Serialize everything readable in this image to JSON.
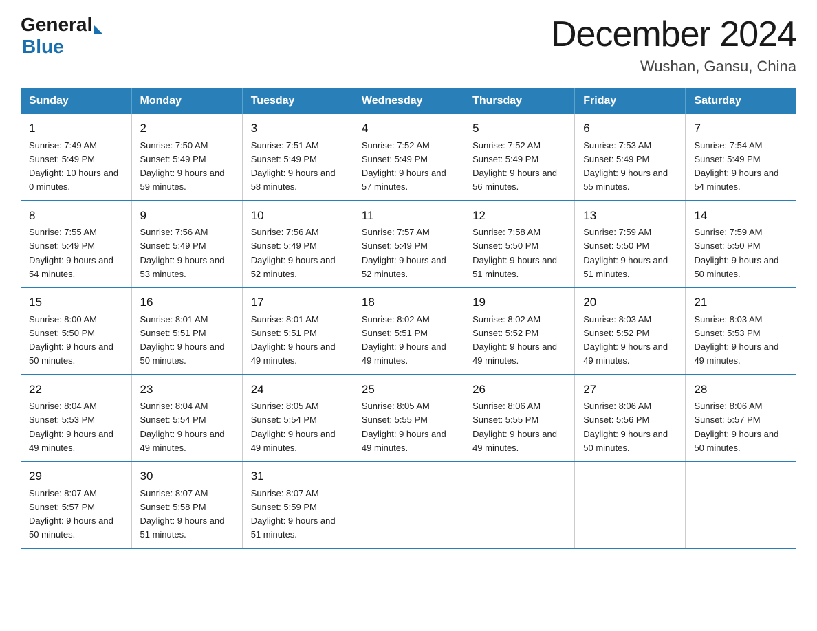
{
  "logo": {
    "text_general": "General",
    "text_blue": "Blue",
    "arrow": true
  },
  "title": "December 2024",
  "subtitle": "Wushan, Gansu, China",
  "days_of_week": [
    "Sunday",
    "Monday",
    "Tuesday",
    "Wednesday",
    "Thursday",
    "Friday",
    "Saturday"
  ],
  "weeks": [
    [
      {
        "day": "1",
        "sunrise": "7:49 AM",
        "sunset": "5:49 PM",
        "daylight": "10 hours and 0 minutes."
      },
      {
        "day": "2",
        "sunrise": "7:50 AM",
        "sunset": "5:49 PM",
        "daylight": "9 hours and 59 minutes."
      },
      {
        "day": "3",
        "sunrise": "7:51 AM",
        "sunset": "5:49 PM",
        "daylight": "9 hours and 58 minutes."
      },
      {
        "day": "4",
        "sunrise": "7:52 AM",
        "sunset": "5:49 PM",
        "daylight": "9 hours and 57 minutes."
      },
      {
        "day": "5",
        "sunrise": "7:52 AM",
        "sunset": "5:49 PM",
        "daylight": "9 hours and 56 minutes."
      },
      {
        "day": "6",
        "sunrise": "7:53 AM",
        "sunset": "5:49 PM",
        "daylight": "9 hours and 55 minutes."
      },
      {
        "day": "7",
        "sunrise": "7:54 AM",
        "sunset": "5:49 PM",
        "daylight": "9 hours and 54 minutes."
      }
    ],
    [
      {
        "day": "8",
        "sunrise": "7:55 AM",
        "sunset": "5:49 PM",
        "daylight": "9 hours and 54 minutes."
      },
      {
        "day": "9",
        "sunrise": "7:56 AM",
        "sunset": "5:49 PM",
        "daylight": "9 hours and 53 minutes."
      },
      {
        "day": "10",
        "sunrise": "7:56 AM",
        "sunset": "5:49 PM",
        "daylight": "9 hours and 52 minutes."
      },
      {
        "day": "11",
        "sunrise": "7:57 AM",
        "sunset": "5:49 PM",
        "daylight": "9 hours and 52 minutes."
      },
      {
        "day": "12",
        "sunrise": "7:58 AM",
        "sunset": "5:50 PM",
        "daylight": "9 hours and 51 minutes."
      },
      {
        "day": "13",
        "sunrise": "7:59 AM",
        "sunset": "5:50 PM",
        "daylight": "9 hours and 51 minutes."
      },
      {
        "day": "14",
        "sunrise": "7:59 AM",
        "sunset": "5:50 PM",
        "daylight": "9 hours and 50 minutes."
      }
    ],
    [
      {
        "day": "15",
        "sunrise": "8:00 AM",
        "sunset": "5:50 PM",
        "daylight": "9 hours and 50 minutes."
      },
      {
        "day": "16",
        "sunrise": "8:01 AM",
        "sunset": "5:51 PM",
        "daylight": "9 hours and 50 minutes."
      },
      {
        "day": "17",
        "sunrise": "8:01 AM",
        "sunset": "5:51 PM",
        "daylight": "9 hours and 49 minutes."
      },
      {
        "day": "18",
        "sunrise": "8:02 AM",
        "sunset": "5:51 PM",
        "daylight": "9 hours and 49 minutes."
      },
      {
        "day": "19",
        "sunrise": "8:02 AM",
        "sunset": "5:52 PM",
        "daylight": "9 hours and 49 minutes."
      },
      {
        "day": "20",
        "sunrise": "8:03 AM",
        "sunset": "5:52 PM",
        "daylight": "9 hours and 49 minutes."
      },
      {
        "day": "21",
        "sunrise": "8:03 AM",
        "sunset": "5:53 PM",
        "daylight": "9 hours and 49 minutes."
      }
    ],
    [
      {
        "day": "22",
        "sunrise": "8:04 AM",
        "sunset": "5:53 PM",
        "daylight": "9 hours and 49 minutes."
      },
      {
        "day": "23",
        "sunrise": "8:04 AM",
        "sunset": "5:54 PM",
        "daylight": "9 hours and 49 minutes."
      },
      {
        "day": "24",
        "sunrise": "8:05 AM",
        "sunset": "5:54 PM",
        "daylight": "9 hours and 49 minutes."
      },
      {
        "day": "25",
        "sunrise": "8:05 AM",
        "sunset": "5:55 PM",
        "daylight": "9 hours and 49 minutes."
      },
      {
        "day": "26",
        "sunrise": "8:06 AM",
        "sunset": "5:55 PM",
        "daylight": "9 hours and 49 minutes."
      },
      {
        "day": "27",
        "sunrise": "8:06 AM",
        "sunset": "5:56 PM",
        "daylight": "9 hours and 50 minutes."
      },
      {
        "day": "28",
        "sunrise": "8:06 AM",
        "sunset": "5:57 PM",
        "daylight": "9 hours and 50 minutes."
      }
    ],
    [
      {
        "day": "29",
        "sunrise": "8:07 AM",
        "sunset": "5:57 PM",
        "daylight": "9 hours and 50 minutes."
      },
      {
        "day": "30",
        "sunrise": "8:07 AM",
        "sunset": "5:58 PM",
        "daylight": "9 hours and 51 minutes."
      },
      {
        "day": "31",
        "sunrise": "8:07 AM",
        "sunset": "5:59 PM",
        "daylight": "9 hours and 51 minutes."
      },
      null,
      null,
      null,
      null
    ]
  ]
}
